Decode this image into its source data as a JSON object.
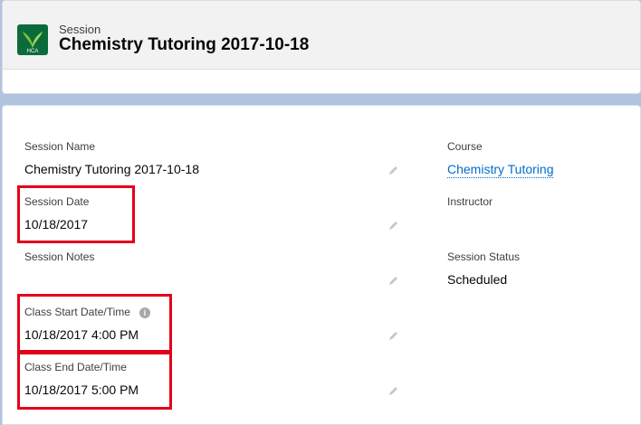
{
  "header": {
    "object_type": "Session",
    "record_title": "Chemistry Tutoring 2017-10-18",
    "logo_text": "HCA",
    "logo_color": "#0c6b3a"
  },
  "fields": {
    "session_name": {
      "label": "Session Name",
      "value": "Chemistry Tutoring 2017-10-18"
    },
    "session_date": {
      "label": "Session Date",
      "value": "10/18/2017"
    },
    "session_notes": {
      "label": "Session Notes",
      "value": ""
    },
    "class_start": {
      "label": "Class Start Date/Time",
      "value": "10/18/2017 4:00 PM"
    },
    "class_end": {
      "label": "Class End Date/Time",
      "value": "10/18/2017 5:00 PM"
    },
    "course": {
      "label": "Course",
      "value": "Chemistry Tutoring"
    },
    "instructor": {
      "label": "Instructor",
      "value": ""
    },
    "session_status": {
      "label": "Session Status",
      "value": "Scheduled"
    }
  },
  "colors": {
    "link": "#006dcc",
    "highlight": "#e3001b",
    "background": "#b0c4df"
  },
  "icons": {
    "edit": "pencil-icon",
    "info": "info-icon"
  }
}
